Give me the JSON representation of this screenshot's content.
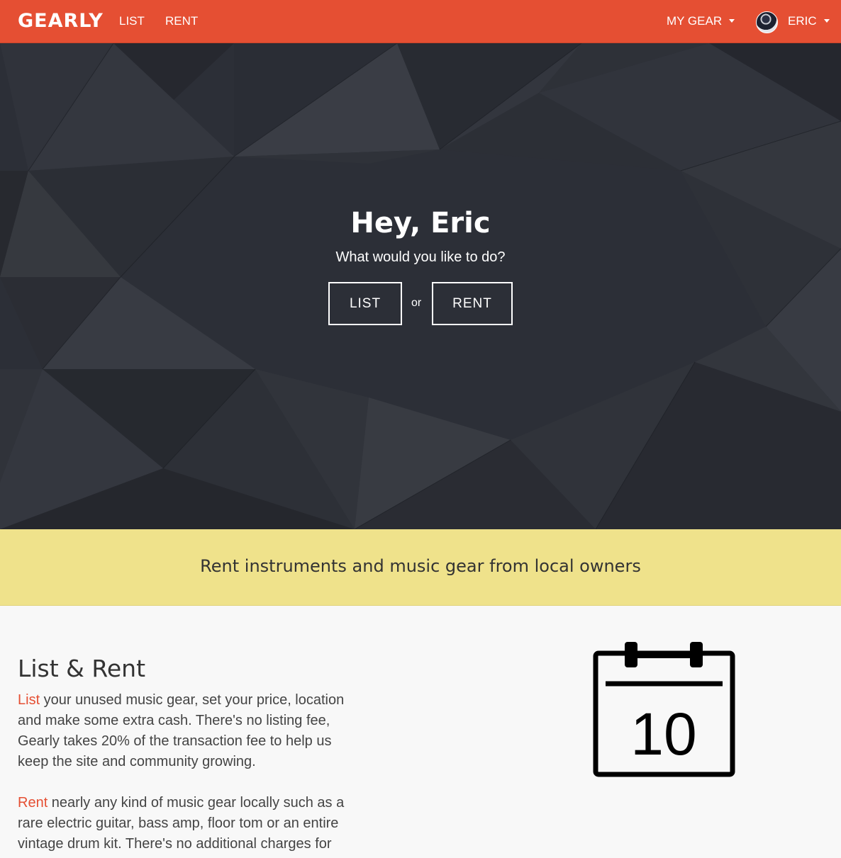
{
  "nav": {
    "brand": "GEARLY",
    "list": "LIST",
    "rent": "RENT",
    "my_gear": "MY GEAR",
    "user": "ERIC"
  },
  "hero": {
    "title": "Hey, Eric",
    "subtitle": "What would you like to do?",
    "list_button": "LIST",
    "or": "or",
    "rent_button": "RENT"
  },
  "banner": {
    "text": "Rent instruments and music gear from local owners"
  },
  "section": {
    "title": "List & Rent",
    "p1_keyword": "List",
    "p1_text": " your unused music gear, set your price, location and make some extra cash. There's no listing fee, Gearly takes 20% of the transaction fee to help us keep the site and community growing.",
    "p2_keyword": "Rent",
    "p2_text": " nearly any kind of music gear locally such as a rare electric guitar, bass amp, floor tom or an entire vintage drum kit. There's no additional charges for",
    "calendar_day": "10"
  },
  "colors": {
    "brand": "#e54f33",
    "hero_bg": "#2c2f37",
    "banner": "#efe28b"
  },
  "icons": [
    "caret-down-icon",
    "avatar",
    "calendar-icon"
  ]
}
